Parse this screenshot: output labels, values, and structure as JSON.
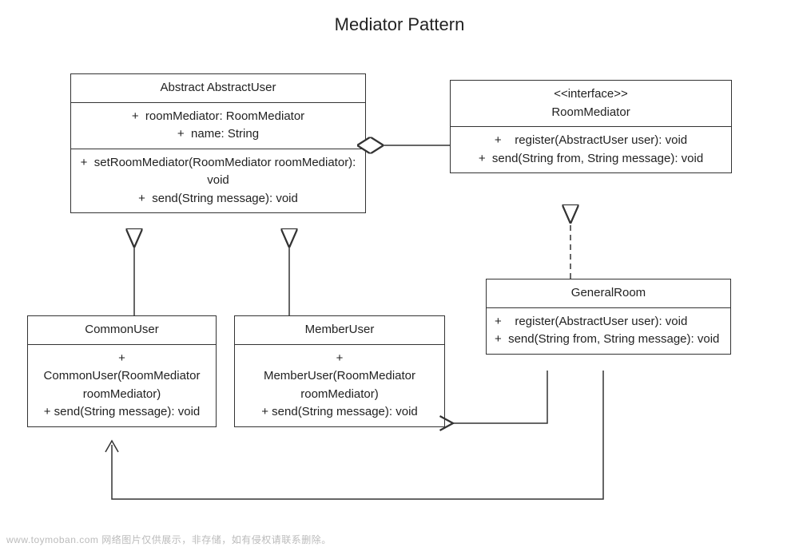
{
  "title": "Mediator Pattern",
  "classes": {
    "abstractUser": {
      "name": "Abstract AbstractUser",
      "attributes": [
        "+  roomMediator: RoomMediator",
        "+  name: String"
      ],
      "operations": [
        "+  setRoomMediator(RoomMediator roomMediator): void",
        "+  send(String message): void"
      ]
    },
    "roomMediator": {
      "stereotype": "<<interface>>",
      "name": "RoomMediator",
      "operations": [
        "+    register(AbstractUser user): void",
        "+  send(String from, String message): void"
      ]
    },
    "commonUser": {
      "name": "CommonUser",
      "operations": [
        "+",
        "CommonUser(RoomMediator roomMediator)",
        "+ send(String message): void"
      ]
    },
    "memberUser": {
      "name": "MemberUser",
      "operations": [
        "+",
        "MemberUser(RoomMediator roomMediator)",
        "+ send(String message): void"
      ]
    },
    "generalRoom": {
      "name": "GeneralRoom",
      "operations": [
        "+    register(AbstractUser user): void",
        "+  send(String from, String message): void"
      ]
    }
  },
  "watermark": "www.toymoban.com  网络图片仅供展示，非存储，如有侵权请联系删除。"
}
